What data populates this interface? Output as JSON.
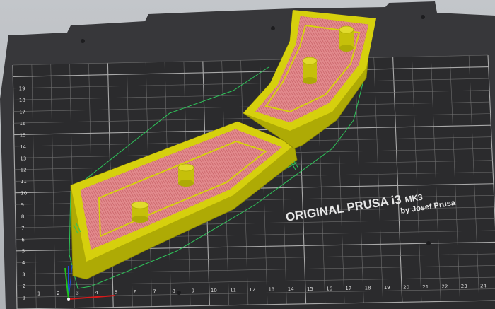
{
  "bed": {
    "brand_line1": "ORIGINAL PRUSA i3",
    "brand_model": "MK3",
    "brand_line2": "by Josef Prusa",
    "x_ticks": [
      "1",
      "2",
      "3",
      "4",
      "5",
      "6",
      "7",
      "8",
      "9",
      "10",
      "11",
      "12",
      "13",
      "14",
      "15",
      "16",
      "17",
      "18",
      "19",
      "20",
      "21",
      "22",
      "23",
      "24"
    ],
    "y_ticks": [
      "1",
      "2",
      "3",
      "4",
      "5",
      "6",
      "7",
      "8",
      "9",
      "10",
      "11",
      "12",
      "13",
      "14",
      "15",
      "16",
      "17",
      "18",
      "19"
    ]
  },
  "colors": {
    "bed_surface": "#2c2c2e",
    "bed_plate": "#39393b",
    "grid_line": "#8f8f8f",
    "part_wall": "#d6d00d",
    "part_wall_dark": "#aeaa05",
    "infill": "#d97a7e",
    "travel_line": "#2ec45a",
    "axis_x": "#d81a1a",
    "axis_y": "#1ec41e",
    "axis_z": "#1f49d8"
  },
  "icons": [
    "axis-gizmo-icon"
  ]
}
